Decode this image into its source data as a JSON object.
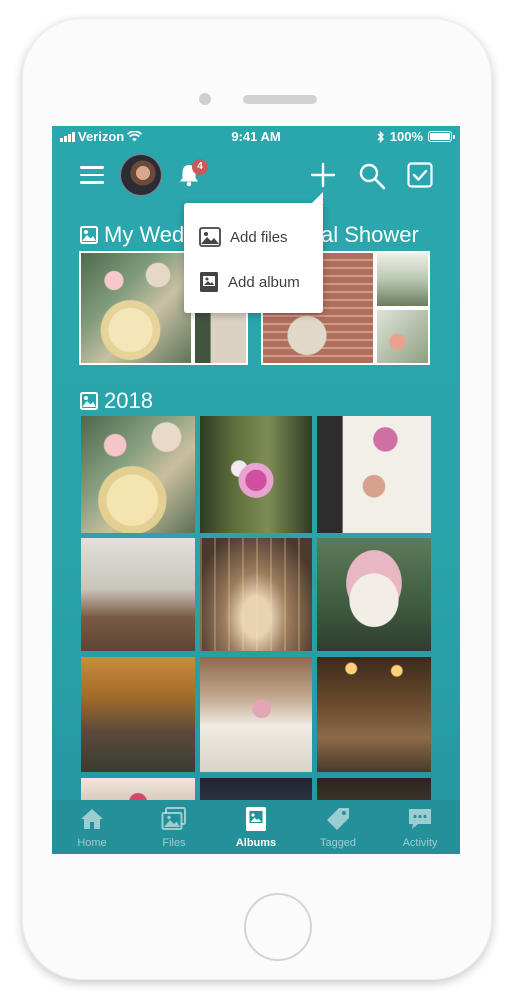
{
  "status": {
    "carrier": "Verizon",
    "time": "9:41 AM",
    "battery": "100%"
  },
  "header": {
    "notification_count": "4"
  },
  "menu": {
    "add_files": "Add files",
    "add_album": "Add album"
  },
  "albums": [
    {
      "title_left": "My Wed",
      "title_right": "al Shower"
    }
  ],
  "sections": [
    {
      "title": "2018"
    }
  ],
  "tabs": [
    {
      "label": "Home",
      "icon": "home-icon"
    },
    {
      "label": "Files",
      "icon": "images-icon"
    },
    {
      "label": "Albums",
      "icon": "album-icon",
      "active": true
    },
    {
      "label": "Tagged",
      "icon": "tag-icon"
    },
    {
      "label": "Activity",
      "icon": "chat-icon"
    }
  ],
  "colors": {
    "teal": "#2aa7ad",
    "tab_bar": "#23909a",
    "badge": "#c95a5a"
  }
}
